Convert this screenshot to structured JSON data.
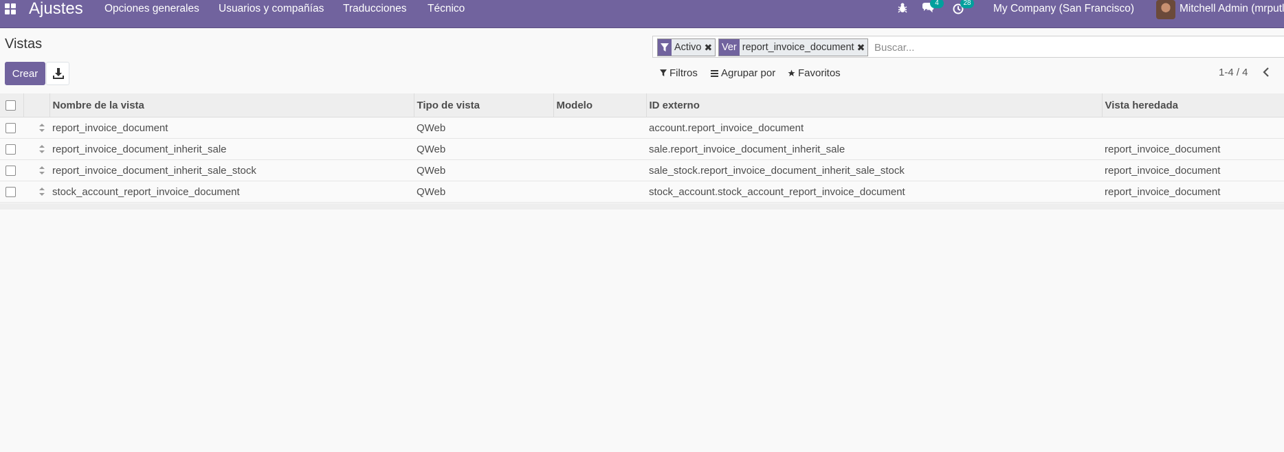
{
  "navbar": {
    "app_title": "Ajustes",
    "menu": [
      "Opciones generales",
      "Usuarios y compañías",
      "Traducciones",
      "Técnico"
    ],
    "messages_count": "4",
    "activities_count": "28",
    "company": "My Company (San Francisco)",
    "user": "Mitchell Admin (mrputls",
    "accent_color": "#71639e",
    "badge_color": "#00a09d"
  },
  "control_panel": {
    "title": "Vistas",
    "facets": [
      {
        "tag_icon": "filter-icon",
        "value": "Activo"
      },
      {
        "tag": "Ver",
        "value": "report_invoice_document"
      }
    ],
    "search_placeholder": "Buscar...",
    "create_label": "Crear",
    "filters_label": "Filtros",
    "groupby_label": "Agrupar por",
    "favorites_label": "Favoritos",
    "pager": "1-4 / 4"
  },
  "table": {
    "headers": [
      "Nombre de la vista",
      "Tipo de vista",
      "Modelo",
      "ID externo",
      "Vista heredada"
    ],
    "rows": [
      {
        "name": "report_invoice_document",
        "type": "QWeb",
        "model": "",
        "xml_id": "account.report_invoice_document",
        "inherit": ""
      },
      {
        "name": "report_invoice_document_inherit_sale",
        "type": "QWeb",
        "model": "",
        "xml_id": "sale.report_invoice_document_inherit_sale",
        "inherit": "report_invoice_document"
      },
      {
        "name": "report_invoice_document_inherit_sale_stock",
        "type": "QWeb",
        "model": "",
        "xml_id": "sale_stock.report_invoice_document_inherit_sale_stock",
        "inherit": "report_invoice_document"
      },
      {
        "name": "stock_account_report_invoice_document",
        "type": "QWeb",
        "model": "",
        "xml_id": "stock_account.stock_account_report_invoice_document",
        "inherit": "report_invoice_document"
      }
    ]
  }
}
